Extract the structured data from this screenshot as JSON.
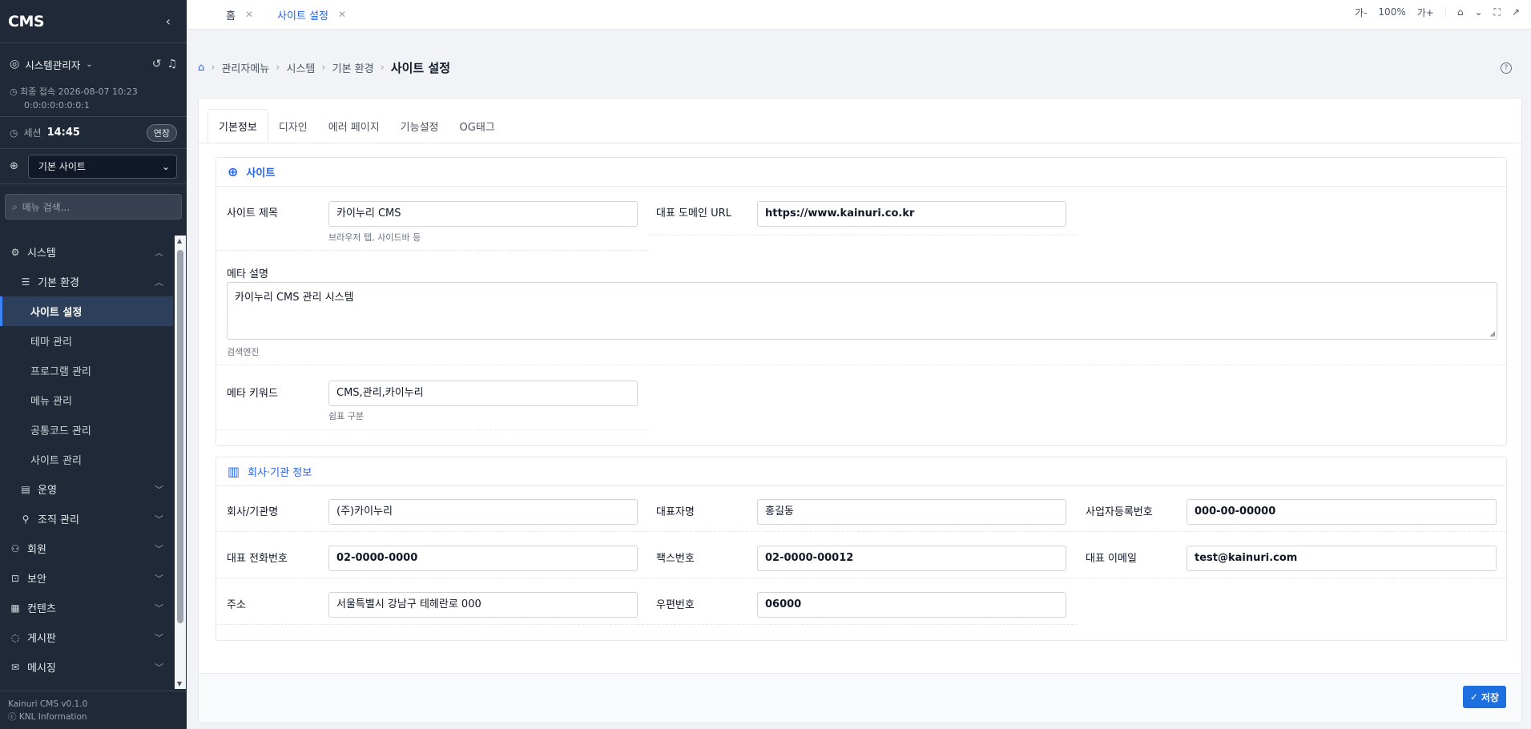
{
  "app": {
    "logo": "CMS",
    "footer_version": "Kainuri CMS v0.1.0",
    "footer_company": "ⓒ KNL Information"
  },
  "user": {
    "name": "시스템관리자"
  },
  "last_login": {
    "label": "최종 접속",
    "datetime": "2026-08-07 10:23",
    "ip": "0:0:0:0:0:0:0:1"
  },
  "session": {
    "label": "세션",
    "time": "14:45",
    "extend_label": "연장"
  },
  "site_select": {
    "value": "기본 사이트"
  },
  "menu_search": {
    "placeholder": "메뉴 검색..."
  },
  "menu": {
    "system": "시스템",
    "basic_env": "기본 환경",
    "site_settings": "사이트 설정",
    "theme": "테마 관리",
    "program": "프로그램 관리",
    "menu_mgmt": "메뉴 관리",
    "common_code": "공통코드 관리",
    "site_mgmt": "사이트 관리",
    "operation": "운영",
    "org": "조직 관리",
    "member": "회원",
    "security": "보안",
    "contents": "컨텐츠",
    "board": "게시판",
    "messaging": "메시징"
  },
  "top_tabs": [
    {
      "label": "홈"
    },
    {
      "label": "사이트 설정"
    }
  ],
  "toolbar": {
    "font_minus": "가-",
    "zoom": "100%",
    "font_plus": "가+"
  },
  "breadcrumb": {
    "admin": "관리자메뉴",
    "system": "시스템",
    "env": "기본 환경",
    "current": "사이트 설정"
  },
  "tabs": [
    "기본정보",
    "디자인",
    "에러 페이지",
    "기능설정",
    "OG태그"
  ],
  "site_panel": {
    "title": "사이트",
    "site_title_label": "사이트 제목",
    "site_title_value": "카이누리 CMS",
    "site_title_hint": "브라우저 탭, 사이드바 등",
    "domain_label": "대표 도메인 URL",
    "domain_value": "https://www.kainuri.co.kr",
    "meta_desc_label": "메타 설명",
    "meta_desc_value": "카이누리 CMS 관리 시스템",
    "meta_desc_hint": "검색엔진",
    "meta_kw_label": "메타 키워드",
    "meta_kw_value": "CMS,관리,카이누리",
    "meta_kw_hint": "쉼표 구분"
  },
  "company_panel": {
    "title": "회사·기관 정보",
    "company_label": "회사/기관명",
    "company_value": "(주)카이누리",
    "ceo_label": "대표자명",
    "ceo_value": "홍길동",
    "bizno_label": "사업자등록번호",
    "bizno_value": "000-00-00000",
    "tel_label": "대표 전화번호",
    "tel_value": "02-0000-0000",
    "fax_label": "팩스번호",
    "fax_value": "02-0000-00012",
    "email_label": "대표 이메일",
    "email_value": "test@kainuri.com",
    "addr_label": "주소",
    "addr_value": "서울특별시 강남구 테헤란로 000",
    "zip_label": "우편번호",
    "zip_value": "06000"
  },
  "save_label": "저장"
}
